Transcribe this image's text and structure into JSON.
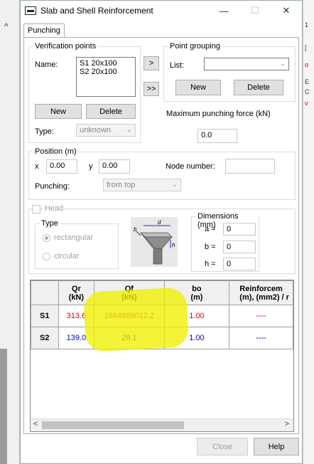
{
  "background": {
    "right_marks": [
      "1",
      "[",
      "ɑ",
      "E",
      "C",
      "v"
    ]
  },
  "window": {
    "title": "Slab and Shell Reinforcement",
    "controls": {
      "minimize": "—",
      "maximize": "☐",
      "close": "✕"
    }
  },
  "tabs": [
    {
      "label": "Punching",
      "active": true
    }
  ],
  "verification": {
    "legend": "Verification points",
    "name_label": "Name:",
    "names": [
      "S1 20x100",
      "S2 20x100"
    ],
    "add_arrow": ">",
    "add_all_arrow": ">>",
    "new_label": "New",
    "delete_label": "Delete",
    "type_label": "Type:",
    "type_value": "unknown"
  },
  "grouping": {
    "legend": "Point grouping",
    "list_label": "List:",
    "list_value": "",
    "new_label": "New",
    "delete_label": "Delete"
  },
  "max_force": {
    "label": "Maximum punching force (kN)",
    "value": "0.0"
  },
  "position": {
    "legend": "Position (m)",
    "x_label": "x",
    "x_value": "0.00",
    "y_label": "y",
    "y_value": "0.00",
    "node_label": "Node number:",
    "node_value": "",
    "punching_label": "Punching:",
    "punching_value": "from top"
  },
  "head": {
    "label": "Head",
    "type_legend": "Type",
    "rect_label": "rectangular",
    "circ_label": "circular",
    "dimensions_legend": "Dimensions (mm)",
    "a_label": "a =",
    "a_value": "0",
    "b_label": "b =",
    "b_value": "0",
    "h_label": "h =",
    "h_value": "0",
    "diagram_labels": {
      "d": "d",
      "b": "b",
      "h": "h"
    }
  },
  "table": {
    "columns": [
      "",
      "Qr\n(kN)",
      "Qf\n(kN)",
      "bo\n(m)",
      "Reinforcem\n(m), (mm2) / r"
    ],
    "col1": {
      "line1": "Qr",
      "line2": "(kN)"
    },
    "col2": {
      "line1": "Qf",
      "line2": "(kN)"
    },
    "col3": {
      "line1": "bo",
      "line2": "(m)"
    },
    "col4": {
      "line1": "Reinforcem",
      "line2": "(m), (mm2) / r"
    },
    "rows": [
      {
        "name": "S1",
        "qr": "313.6",
        "qf": "1664688012.2",
        "bo": "1.00",
        "reinf": "----",
        "color": "#e00000"
      },
      {
        "name": "S2",
        "qr": "139.0",
        "qf": "29.1",
        "bo": "1.00",
        "reinf": "----",
        "color": "#0000d0"
      }
    ],
    "scroll_left": "<",
    "scroll_right": ">"
  },
  "footer": {
    "close_label": "Close",
    "help_label": "Help"
  },
  "colors": {
    "highlight": "#f0f000",
    "error_red": "#e00000",
    "ok_blue": "#0000d0"
  }
}
